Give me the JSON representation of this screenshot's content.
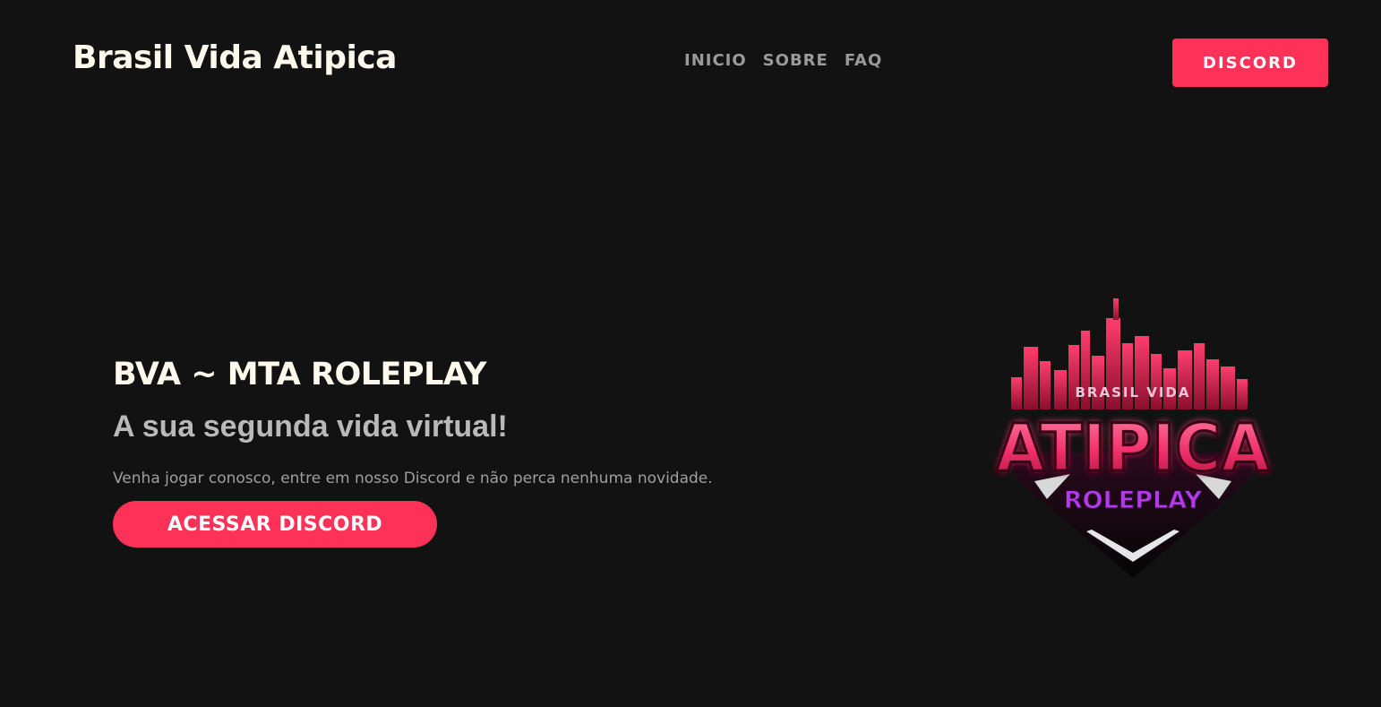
{
  "header": {
    "brand": "Brasil Vida Atipica",
    "nav": [
      {
        "label": "INICIO"
      },
      {
        "label": "SOBRE"
      },
      {
        "label": "FAQ"
      }
    ],
    "cta_label": "DISCORD"
  },
  "hero": {
    "title": "BVA ~ MTA ROLEPLAY",
    "subtitle": "A sua segunda vida virtual!",
    "description": "Venha jogar conosco, entre em nosso Discord e não perca nenhuma novidade.",
    "button_label": "ACESSAR DISCORD"
  },
  "logo": {
    "top_text": "BRASIL VIDA",
    "main_text": "ATIPICA",
    "sub_text": "ROLEPLAY"
  },
  "colors": {
    "background": "#121212",
    "accent": "#fe3158",
    "heading": "#fff8ec",
    "nav": "#9a9a9a"
  }
}
